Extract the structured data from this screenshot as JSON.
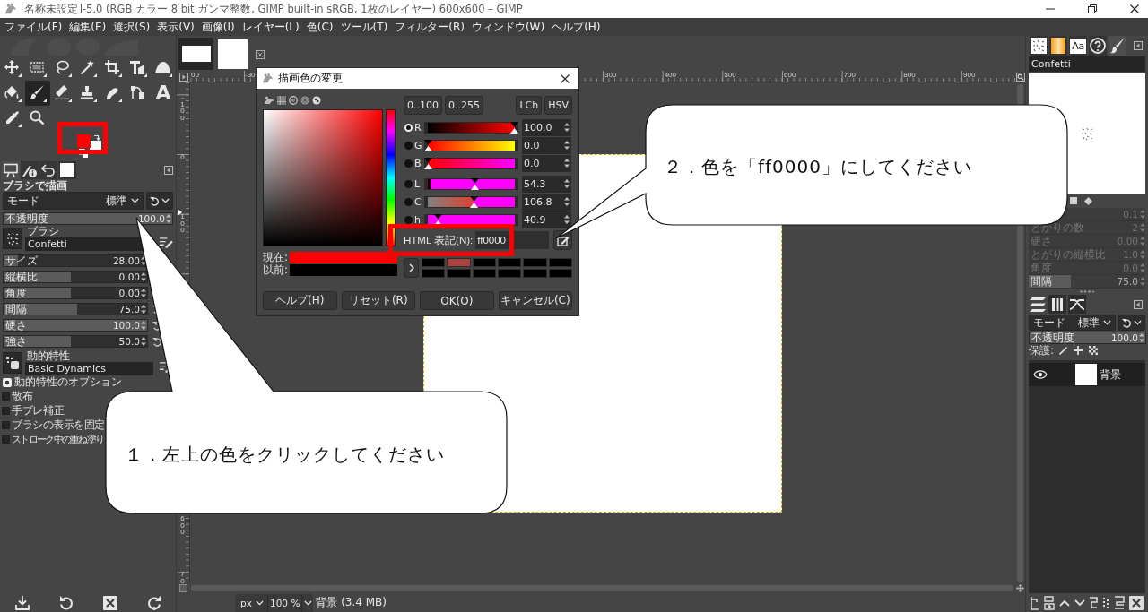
{
  "window": {
    "title": "[名称未設定]-5.0 (RGB カラー 8 bit ガンマ整数, GIMP built-in sRGB, 1枚のレイヤー) 600x600 – GIMP"
  },
  "menu": [
    "ファイル(F)",
    "編集(E)",
    "選択(S)",
    "表示(V)",
    "画像(I)",
    "レイヤー(L)",
    "色(C)",
    "ツール(T)",
    "フィルター(R)",
    "ウィンドウ(W)",
    "ヘルプ(H)"
  ],
  "toolbox": {
    "tools": [
      {
        "kind": "move",
        "selected": false
      },
      {
        "kind": "rect-select",
        "selected": false
      },
      {
        "kind": "lasso",
        "selected": false
      },
      {
        "kind": "wand",
        "selected": false
      },
      {
        "kind": "crop",
        "selected": false
      },
      {
        "kind": "transform",
        "selected": false
      },
      {
        "kind": "warp",
        "selected": false
      },
      {
        "kind": "bucket",
        "selected": false
      },
      {
        "kind": "brush",
        "selected": true
      },
      {
        "kind": "eraser",
        "selected": false
      },
      {
        "kind": "stamp",
        "selected": false
      },
      {
        "kind": "smudge",
        "selected": false
      },
      {
        "kind": "paths",
        "selected": false
      },
      {
        "kind": "text",
        "glyph": "A",
        "selected": false
      },
      {
        "kind": "picker",
        "selected": false
      },
      {
        "kind": "zoom",
        "selected": false
      }
    ],
    "colors": [
      {
        "kind": "foreground",
        "color": "#ff0000"
      },
      {
        "kind": "background",
        "color": "#ffffff"
      }
    ]
  },
  "tool_options": {
    "tabs": [
      {
        "kind": "tool-options",
        "selected": true
      },
      {
        "kind": "device-status",
        "selected": false
      },
      {
        "kind": "undo",
        "selected": false
      },
      {
        "kind": "images",
        "selected": false
      }
    ],
    "title": "ブラシで描画",
    "mode": {
      "label": "モード",
      "value": "標準"
    },
    "opacity": {
      "label": "不透明度",
      "reading": "100.0",
      "level": 1
    },
    "brush": {
      "label": "ブラシ",
      "value": "Confetti"
    },
    "sliders": [
      {
        "label": "サイズ",
        "reading": "28.00",
        "level": 0.1
      },
      {
        "label": "縦横比",
        "reading": "0.00",
        "level": 0.47
      },
      {
        "label": "角度",
        "reading": "0.00",
        "level": 0.47
      },
      {
        "label": "間隔",
        "reading": "75.0",
        "level": 0.51
      },
      {
        "label": "硬さ",
        "reading": "100.0",
        "level": 1
      },
      {
        "label": "強さ",
        "reading": "50.0",
        "level": 0.47
      }
    ],
    "dynamics": {
      "label": "動的特性",
      "value": "Basic Dynamics"
    },
    "dynamics_options": {
      "label": "動的特性のオプション",
      "expanded": false
    },
    "checkboxes": [
      {
        "label": "散布",
        "checked": false
      },
      {
        "label": "手ブレ補正",
        "checked": false
      },
      {
        "label": "ブラシの表示を固定",
        "checked": false
      },
      {
        "label": "ストローク中の重ね塗り",
        "checked": false
      }
    ]
  },
  "image_window": {
    "tabs": [
      {
        "kind": "wide",
        "selected": true
      },
      {
        "kind": "square",
        "selected": false
      }
    ],
    "ruler_top": {
      "left_labels": [
        "00",
        "-30"
      ],
      "right_labels": [
        "300",
        "400",
        "500",
        "600",
        "700",
        "800",
        "900"
      ]
    },
    "ruler_left": {
      "top_labels": [
        "-100",
        "0",
        "100"
      ],
      "bottom_labels": [
        "600",
        "70"
      ]
    }
  },
  "status_bar": {
    "unit": "px",
    "zoom": "100 %",
    "message": "背景 (3.4 MB)"
  },
  "brush_editor": {
    "tabs": [
      {
        "kind": "brushes",
        "selected": false
      },
      {
        "kind": "gradients",
        "selected": false
      },
      {
        "kind": "fonts",
        "glyph": "Aa",
        "selected": false
      },
      {
        "kind": "help",
        "selected": false
      },
      {
        "kind": "brush-editor",
        "selected": true
      }
    ],
    "name": "Confetti",
    "sliders": [
      {
        "reading": "0.1",
        "disabled": true
      },
      {
        "label": "とがりの数",
        "reading": "2",
        "disabled": true
      },
      {
        "label": "硬さ",
        "reading": "0.00",
        "disabled": true
      },
      {
        "label": "とがりの縦横比",
        "reading": "1.0",
        "disabled": true
      },
      {
        "label": "角度",
        "reading": "0.0",
        "disabled": true
      },
      {
        "label": "間隔",
        "reading": "75.0",
        "disabled": false,
        "level": 0.36
      }
    ]
  },
  "layers": {
    "tabs": [
      {
        "kind": "layers",
        "selected": true
      },
      {
        "kind": "channels",
        "selected": false
      },
      {
        "kind": "paths",
        "selected": false
      }
    ],
    "mode": {
      "label": "モード",
      "value": "標準"
    },
    "opacity": {
      "label": "不透明度",
      "reading": "100.0",
      "level": 1
    },
    "lock_label": "保護:",
    "items": [
      {
        "name": "背景",
        "visible": true,
        "selected": true
      }
    ]
  },
  "color_dialog": {
    "title": "描画色の変更",
    "range_buttons": [
      "0..100",
      "0..255"
    ],
    "model_buttons": [
      "LCh",
      "HSV"
    ],
    "channels": [
      {
        "kind": "red",
        "label": "R",
        "reading": "100.0",
        "level": 1,
        "selected": true
      },
      {
        "kind": "green",
        "label": "G",
        "reading": "0.0",
        "level": 0,
        "selected": false
      },
      {
        "kind": "blue",
        "label": "B",
        "reading": "0.0",
        "level": 0,
        "selected": false
      },
      {
        "kind": "lightness",
        "label": "L",
        "reading": "54.3",
        "level": 0.543,
        "selected": false
      },
      {
        "kind": "chroma",
        "label": "C",
        "reading": "106.8",
        "level": 0.534,
        "selected": false
      },
      {
        "kind": "hue",
        "label": "h",
        "reading": "40.9",
        "level": 0.114,
        "selected": false
      }
    ],
    "html": {
      "label": "HTML 表記(N):",
      "value": "ff0000"
    },
    "compare": [
      {
        "label": "現在:",
        "color": "#ff0000"
      },
      {
        "label": "以前:",
        "color": "#000000"
      }
    ],
    "history": [
      {
        "color": "#000000"
      },
      {
        "color": "#a8423a"
      },
      {
        "color": "#000000"
      },
      {
        "color": "#000000"
      },
      {
        "color": "#000000"
      },
      {
        "color": "#000000"
      },
      {
        "color": "#000000"
      },
      {
        "color": "#000000"
      },
      {
        "color": "#000000"
      },
      {
        "color": "#000000"
      },
      {
        "color": "#000000"
      },
      {
        "color": "#000000"
      }
    ],
    "buttons": [
      "ヘルプ(H)",
      "リセット(R)",
      "OK(O)",
      "キャンセル(C)"
    ]
  },
  "callouts": [
    {
      "text": "１．左上の色をクリックしてください"
    },
    {
      "text": "２．色を「ff0000」にしてください"
    }
  ]
}
